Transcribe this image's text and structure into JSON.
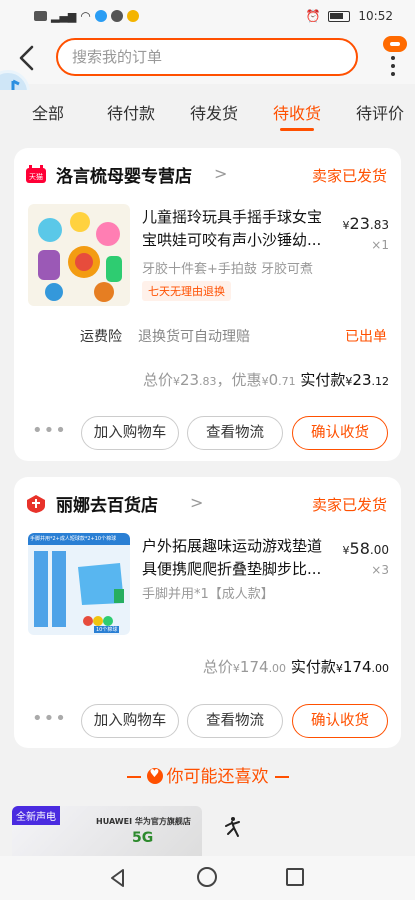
{
  "status_bar": {
    "time": "10:52"
  },
  "header": {
    "search_placeholder": "搜索我的订单"
  },
  "tabs": [
    {
      "label": "全部"
    },
    {
      "label": "待付款"
    },
    {
      "label": "待发货"
    },
    {
      "label": "待收货",
      "active": true
    },
    {
      "label": "待评价"
    }
  ],
  "orders": [
    {
      "shop_badge": "天猫",
      "shop_name": "洛言梳母婴专营店",
      "status": "卖家已发货",
      "title": "儿童摇玲玩具手摇手球女宝宝哄娃可咬有声小沙锤幼...",
      "price_currency": "¥",
      "price_int": "23",
      "price_dec": ".83",
      "qty": "×1",
      "spec": "牙胶十件套+手拍鼓 牙胶可煮",
      "badge": "七天无理由退换",
      "insurance_label": "运费险",
      "insurance_desc": "退换货可自动理赔",
      "insurance_status": "已出单",
      "total_prefix": "总价",
      "total_int": "23",
      "total_dec": ".83",
      "discount_prefix": "，优惠",
      "discount_int": "0",
      "discount_dec": ".71",
      "paid_prefix": "实付款",
      "paid_int": "23",
      "paid_dec": ".12",
      "more": "•••",
      "buttons": {
        "cart": "加入购物车",
        "logistics": "查看物流",
        "confirm": "确认收货"
      }
    },
    {
      "shop_name": "丽娜去百货店",
      "status": "卖家已发货",
      "title": "户外拓展趣味运动游戏垫道具便携爬爬折叠垫脚步比...",
      "price_currency": "¥",
      "price_int": "58",
      "price_dec": ".00",
      "qty": "×3",
      "spec": "手脚并用*1【成人款】",
      "thumb_text": "手脚并用*2+成人短球款*2+10个棉球",
      "thumb_balls_text": "10个棉球",
      "total_prefix": "总价",
      "total_int": "174",
      "total_dec": ".00",
      "paid_prefix": "实付款",
      "paid_int": "174",
      "paid_dec": ".00",
      "more": "•••",
      "buttons": {
        "cart": "加入购物车",
        "logistics": "查看物流",
        "confirm": "确认收货"
      }
    }
  ],
  "recommend": {
    "title": "你可能还喜欢",
    "ad_tag": "全新声电",
    "ad_brand": "HUAWEI  华为官方旗舰店",
    "ad_5g": "5G"
  },
  "colors": {
    "accent": "#ff5000",
    "background": "#f2f2f2"
  }
}
